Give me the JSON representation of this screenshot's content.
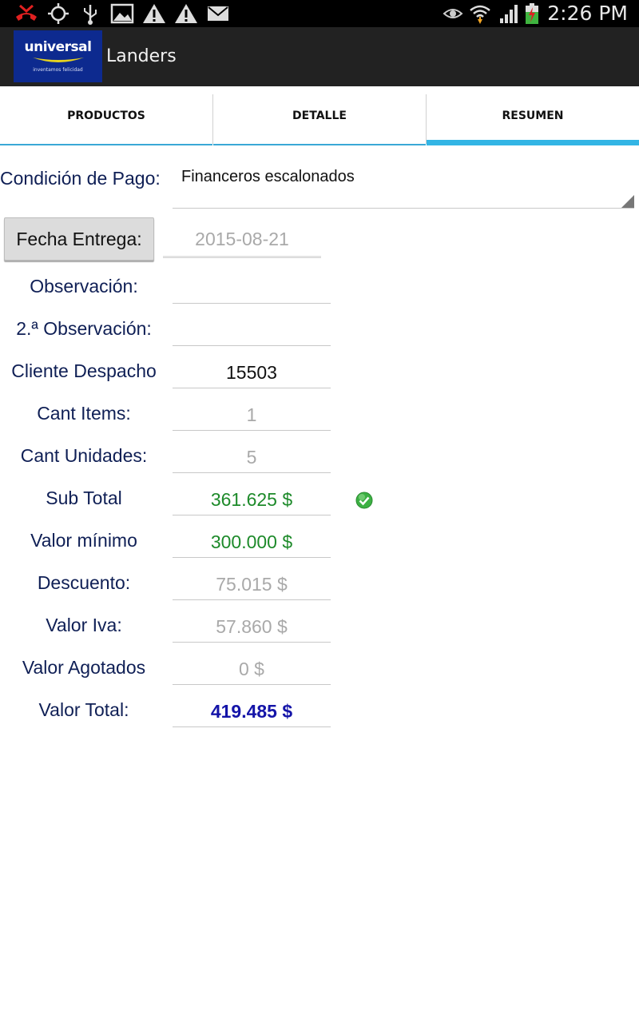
{
  "status_bar": {
    "time": "2:26 PM",
    "icons": [
      "missed-call-icon",
      "gps-icon",
      "usb-icon",
      "image-icon",
      "warning-icon",
      "warning-icon",
      "email-icon",
      "eye-icon",
      "wifi-icon",
      "signal-icon",
      "battery-charging-icon"
    ]
  },
  "action_bar": {
    "logo_text": "universal",
    "logo_tagline": "inventamos felicidad",
    "title": "Landers",
    "logo_color": "#0d2a8f"
  },
  "tabs": [
    {
      "label": "PRODUCTOS",
      "active": false
    },
    {
      "label": "DETALLE",
      "active": false
    },
    {
      "label": "RESUMEN",
      "active": true
    }
  ],
  "form": {
    "condicion_label": "Condición de Pago:",
    "condicion_value": "Financeros escalonados",
    "fecha_button": "Fecha Entrega:",
    "fecha_value": "2015-08-21",
    "observacion_label": "Observación:",
    "observacion_value": "",
    "observacion2_label": "2.ª Observación:",
    "observacion2_value": "",
    "cliente_label": "Cliente Despacho",
    "cliente_value": "15503",
    "cant_items_label": "Cant Items:",
    "cant_items_value": "1",
    "cant_unidades_label": "Cant Unidades:",
    "cant_unidades_value": "5",
    "subtotal_label": "Sub Total",
    "subtotal_value": "361.625 $",
    "valor_minimo_label": "Valor mínimo",
    "valor_minimo_value": "300.000 $",
    "descuento_label": "Descuento:",
    "descuento_value": "75.015 $",
    "iva_label": "Valor Iva:",
    "iva_value": "57.860 $",
    "agotados_label": "Valor Agotados",
    "agotados_value": "0 $",
    "total_label": "Valor Total:",
    "total_value": "419.485 $"
  },
  "colors": {
    "accent": "#33b5e5",
    "label": "#0f1f55",
    "green_value": "#1d8a2a",
    "total_value": "#1414a8"
  }
}
